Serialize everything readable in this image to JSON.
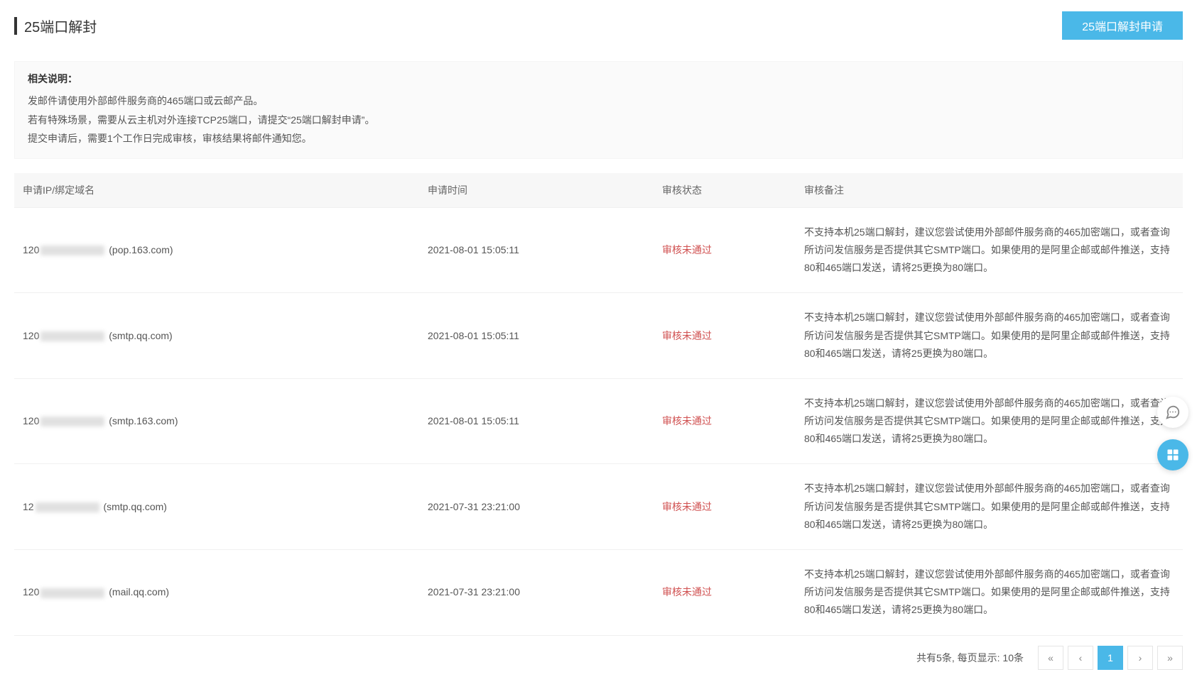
{
  "header": {
    "title": "25端口解封",
    "apply_button": "25端口解封申请"
  },
  "notice": {
    "title": "相关说明：",
    "lines": [
      "发邮件请使用外部邮件服务商的465端口或云邮产品。",
      "若有特殊场景，需要从云主机对外连接TCP25端口，请提交“25端口解封申请”。",
      "提交申请后，需要1个工作日完成审核，审核结果将邮件通知您。"
    ]
  },
  "table": {
    "headers": {
      "ip": "申请IP/绑定域名",
      "time": "申请时间",
      "status": "审核状态",
      "note": "审核备注"
    },
    "rows": [
      {
        "ip_prefix": "120",
        "domain": "(pop.163.com)",
        "time": "2021-08-01 15:05:11",
        "status": "审核未通过",
        "note": "不支持本机25端口解封，建议您尝试使用外部邮件服务商的465加密端口，或者查询所访问发信服务是否提供其它SMTP端口。如果使用的是阿里企邮或邮件推送，支持80和465端口发送，请将25更换为80端口。"
      },
      {
        "ip_prefix": "120",
        "domain": "(smtp.qq.com)",
        "time": "2021-08-01 15:05:11",
        "status": "审核未通过",
        "note": "不支持本机25端口解封，建议您尝试使用外部邮件服务商的465加密端口，或者查询所访问发信服务是否提供其它SMTP端口。如果使用的是阿里企邮或邮件推送，支持80和465端口发送，请将25更换为80端口。"
      },
      {
        "ip_prefix": "120",
        "domain": "(smtp.163.com)",
        "time": "2021-08-01 15:05:11",
        "status": "审核未通过",
        "note": "不支持本机25端口解封，建议您尝试使用外部邮件服务商的465加密端口，或者查询所访问发信服务是否提供其它SMTP端口。如果使用的是阿里企邮或邮件推送，支持80和465端口发送，请将25更换为80端口。"
      },
      {
        "ip_prefix": "12",
        "domain": "(smtp.qq.com)",
        "time": "2021-07-31 23:21:00",
        "status": "审核未通过",
        "note": "不支持本机25端口解封，建议您尝试使用外部邮件服务商的465加密端口，或者查询所访问发信服务是否提供其它SMTP端口。如果使用的是阿里企邮或邮件推送，支持80和465端口发送，请将25更换为80端口。"
      },
      {
        "ip_prefix": "120",
        "domain": "(mail.qq.com)",
        "time": "2021-07-31 23:21:00",
        "status": "审核未通过",
        "note": "不支持本机25端口解封，建议您尝试使用外部邮件服务商的465加密端口，或者查询所访问发信服务是否提供其它SMTP端口。如果使用的是阿里企邮或邮件推送，支持80和465端口发送，请将25更换为80端口。"
      }
    ]
  },
  "pagination": {
    "total_text": "共有5条,",
    "per_page_label": "每页显示:",
    "per_page_value": "10条",
    "current_page": "1",
    "first": "«",
    "prev": "‹",
    "next": "›",
    "last": "»"
  }
}
